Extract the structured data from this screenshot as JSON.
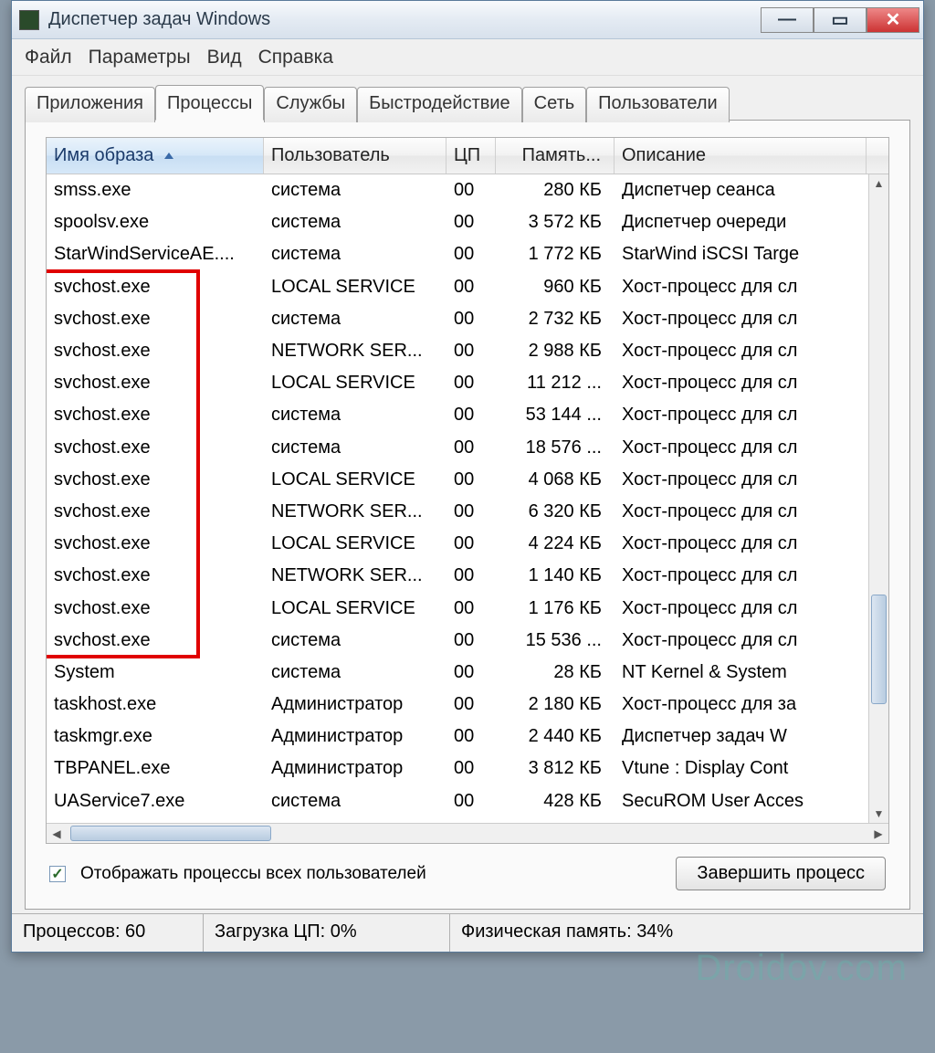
{
  "window": {
    "title": "Диспетчер задач Windows"
  },
  "menu": {
    "file": "Файл",
    "options": "Параметры",
    "view": "Вид",
    "help": "Справка"
  },
  "tabs": {
    "applications": "Приложения",
    "processes": "Процессы",
    "services": "Службы",
    "performance": "Быстродействие",
    "networking": "Сеть",
    "users": "Пользователи"
  },
  "columns": {
    "name": "Имя образа",
    "user": "Пользователь",
    "cpu": "ЦП",
    "memory": "Память...",
    "description": "Описание"
  },
  "rows": [
    {
      "name": "smss.exe",
      "user": "система",
      "cpu": "00",
      "mem": "280 КБ",
      "desc": "Диспетчер сеанса"
    },
    {
      "name": "spoolsv.exe",
      "user": "система",
      "cpu": "00",
      "mem": "3 572 КБ",
      "desc": "Диспетчер очереди"
    },
    {
      "name": "StarWindServiceAE....",
      "user": "система",
      "cpu": "00",
      "mem": "1 772 КБ",
      "desc": "StarWind iSCSI Targe"
    },
    {
      "name": "svchost.exe",
      "user": "LOCAL SERVICE",
      "cpu": "00",
      "mem": "960 КБ",
      "desc": "Хост-процесс для сл"
    },
    {
      "name": "svchost.exe",
      "user": "система",
      "cpu": "00",
      "mem": "2 732 КБ",
      "desc": "Хост-процесс для сл"
    },
    {
      "name": "svchost.exe",
      "user": "NETWORK SER...",
      "cpu": "00",
      "mem": "2 988 КБ",
      "desc": "Хост-процесс для сл"
    },
    {
      "name": "svchost.exe",
      "user": "LOCAL SERVICE",
      "cpu": "00",
      "mem": "11 212 ...",
      "desc": "Хост-процесс для сл"
    },
    {
      "name": "svchost.exe",
      "user": "система",
      "cpu": "00",
      "mem": "53 144 ...",
      "desc": "Хост-процесс для сл"
    },
    {
      "name": "svchost.exe",
      "user": "система",
      "cpu": "00",
      "mem": "18 576 ...",
      "desc": "Хост-процесс для сл"
    },
    {
      "name": "svchost.exe",
      "user": "LOCAL SERVICE",
      "cpu": "00",
      "mem": "4 068 КБ",
      "desc": "Хост-процесс для сл"
    },
    {
      "name": "svchost.exe",
      "user": "NETWORK SER...",
      "cpu": "00",
      "mem": "6 320 КБ",
      "desc": "Хост-процесс для сл"
    },
    {
      "name": "svchost.exe",
      "user": "LOCAL SERVICE",
      "cpu": "00",
      "mem": "4 224 КБ",
      "desc": "Хост-процесс для сл"
    },
    {
      "name": "svchost.exe",
      "user": "NETWORK SER...",
      "cpu": "00",
      "mem": "1 140 КБ",
      "desc": "Хост-процесс для сл"
    },
    {
      "name": "svchost.exe",
      "user": "LOCAL SERVICE",
      "cpu": "00",
      "mem": "1 176 КБ",
      "desc": "Хост-процесс для сл"
    },
    {
      "name": "svchost.exe",
      "user": "система",
      "cpu": "00",
      "mem": "15 536 ...",
      "desc": "Хост-процесс для сл"
    },
    {
      "name": "System",
      "user": "система",
      "cpu": "00",
      "mem": "28 КБ",
      "desc": "NT Kernel & System"
    },
    {
      "name": "taskhost.exe",
      "user": "Администратор",
      "cpu": "00",
      "mem": "2 180 КБ",
      "desc": "Хост-процесс для за"
    },
    {
      "name": "taskmgr.exe",
      "user": "Администратор",
      "cpu": "00",
      "mem": "2 440 КБ",
      "desc": "Диспетчер задач W"
    },
    {
      "name": "TBPANEL.exe",
      "user": "Администратор",
      "cpu": "00",
      "mem": "3 812 КБ",
      "desc": "Vtune : Display Cont"
    },
    {
      "name": "UAService7.exe",
      "user": "система",
      "cpu": "00",
      "mem": "428 КБ",
      "desc": "SecuROM User Acces"
    }
  ],
  "highlight": {
    "startRow": 3,
    "endRow": 14
  },
  "checkbox": {
    "label": "Отображать процессы всех пользователей",
    "checked": true
  },
  "buttons": {
    "endProcess": "Завершить процесс"
  },
  "status": {
    "processes": "Процессов: 60",
    "cpu": "Загрузка ЦП: 0%",
    "memory": "Физическая память: 34%"
  },
  "watermark": "Droidov.com"
}
